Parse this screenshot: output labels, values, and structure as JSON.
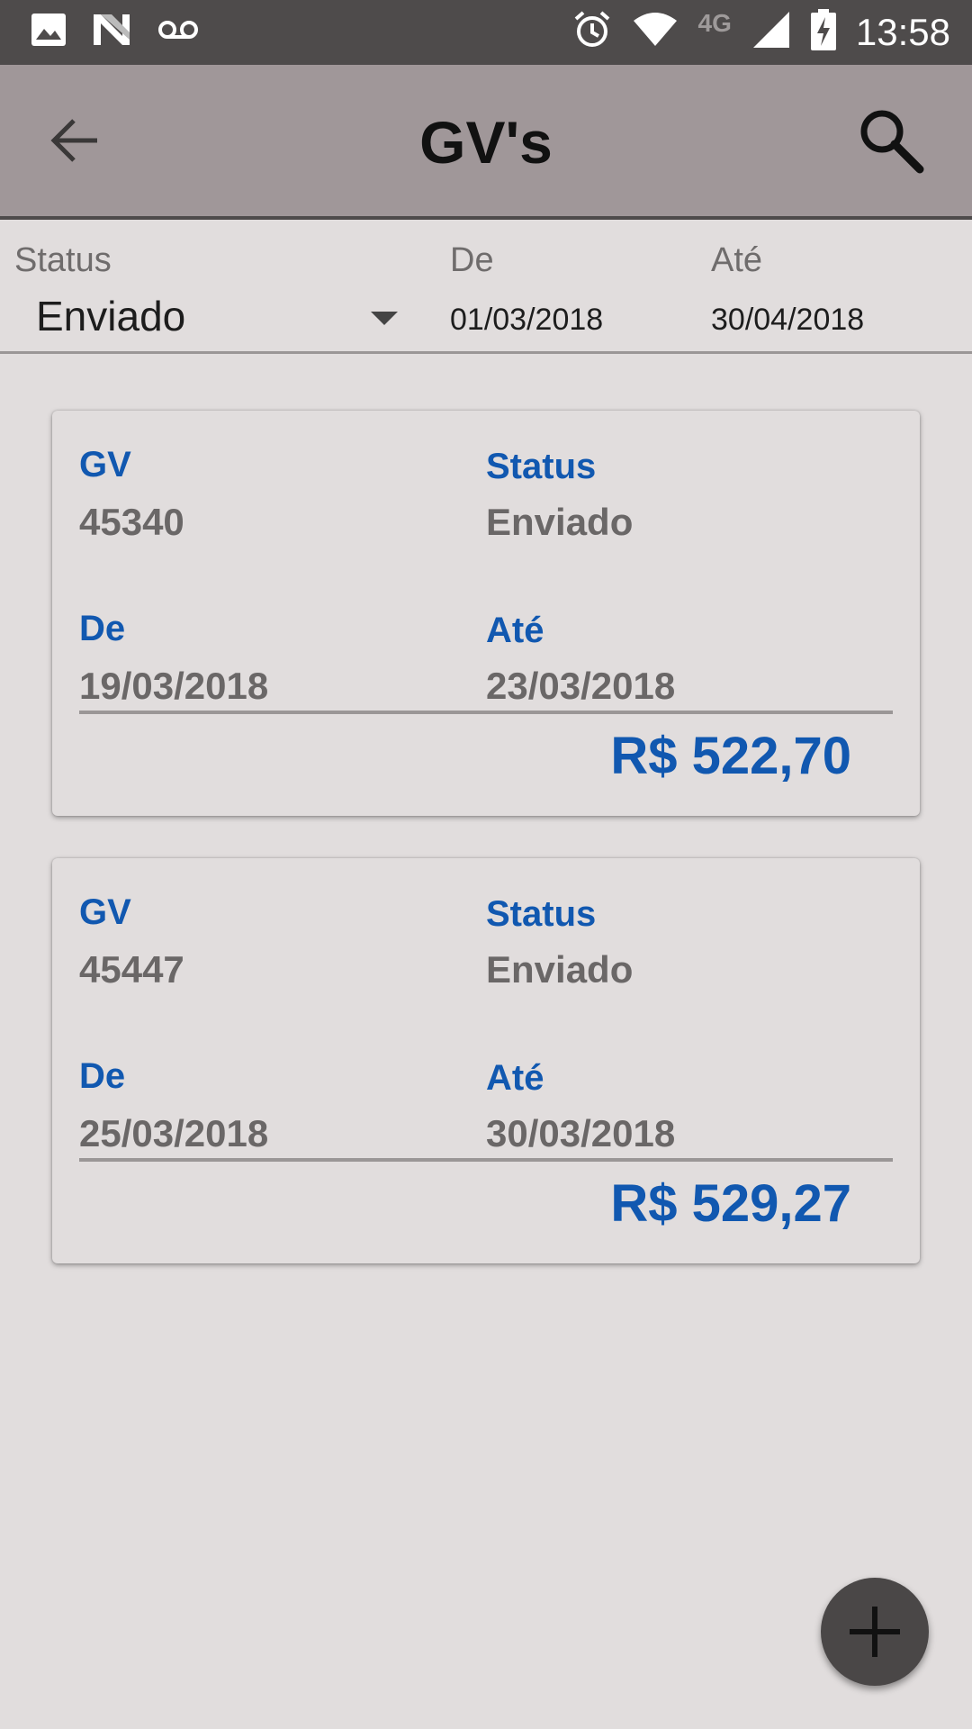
{
  "status_bar": {
    "time": "13:58",
    "network": "4G"
  },
  "app_bar": {
    "title": "GV's"
  },
  "filters": {
    "status_label": "Status",
    "status_value": "Enviado",
    "from_label": "De",
    "from_value": "01/03/2018",
    "to_label": "Até",
    "to_value": "30/04/2018"
  },
  "cards": [
    {
      "gv_label": "GV",
      "gv_value": "45340",
      "status_label": "Status",
      "status_value": "Enviado",
      "from_label": "De",
      "from_value": "19/03/2018",
      "to_label": "Até",
      "to_value": "23/03/2018",
      "total": "R$ 522,70"
    },
    {
      "gv_label": "GV",
      "gv_value": "45447",
      "status_label": "Status",
      "status_value": "Enviado",
      "from_label": "De",
      "from_value": "25/03/2018",
      "to_label": "Até",
      "to_value": "30/03/2018",
      "total": "R$ 529,27"
    }
  ],
  "colors": {
    "accent": "#1158b0",
    "appbar": "#a09799",
    "statusbar": "#4e4b4b",
    "background": "#e1dddd"
  },
  "icons": [
    "image-icon",
    "n-icon",
    "voicemail-icon",
    "alarm-icon",
    "wifi-icon",
    "signal-icon",
    "battery-charging-icon",
    "back-arrow-icon",
    "search-icon",
    "add-icon"
  ]
}
